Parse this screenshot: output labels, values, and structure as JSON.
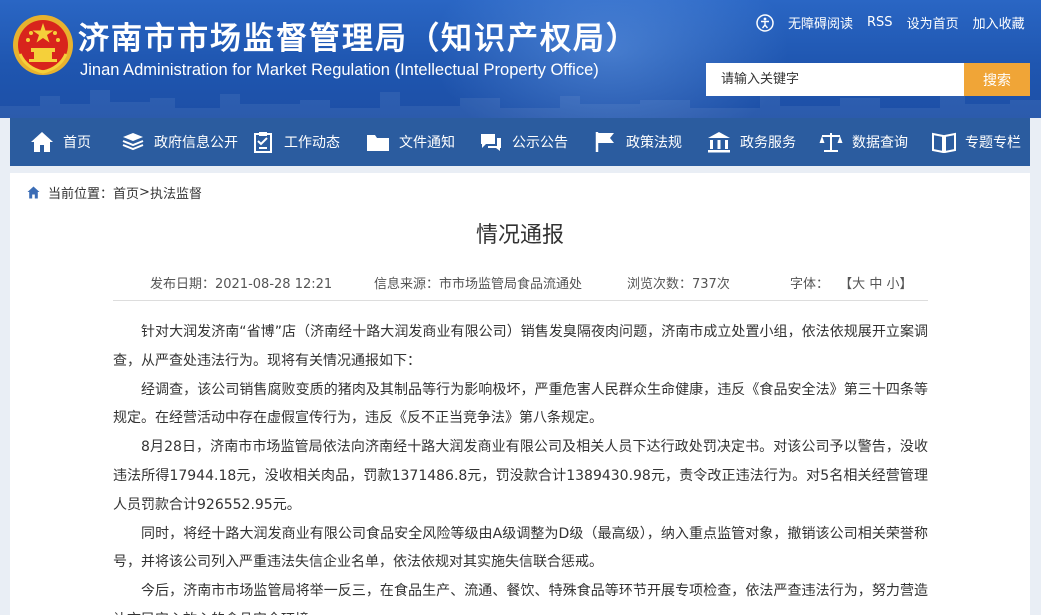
{
  "header": {
    "title_cn": "济南市市场监督管理局（知识产权局）",
    "title_en": "Jinan Administration for Market Regulation (Intellectual Property Office)",
    "emblem_icon": "national-emblem-icon",
    "toplinks": {
      "accessibility": "无障碍阅读",
      "rss": "RSS",
      "homepage": "设为首页",
      "favorite": "加入收藏"
    },
    "search": {
      "placeholder": "请输入关键字",
      "button": "搜索"
    }
  },
  "nav": {
    "items": [
      {
        "label": "首页",
        "icon": "home-icon"
      },
      {
        "label": "政府信息公开",
        "icon": "stack-icon"
      },
      {
        "label": "工作动态",
        "icon": "clipboard-icon"
      },
      {
        "label": "文件通知",
        "icon": "folder-icon"
      },
      {
        "label": "公示公告",
        "icon": "chat-icon"
      },
      {
        "label": "政策法规",
        "icon": "flag-icon"
      },
      {
        "label": "政务服务",
        "icon": "building-icon"
      },
      {
        "label": "数据查询",
        "icon": "scale-icon"
      },
      {
        "label": "专题专栏",
        "icon": "book-icon"
      }
    ]
  },
  "breadcrumb": {
    "prefix": "当前位置：",
    "home": "首页",
    "separator": ">",
    "current": "执法监督"
  },
  "article": {
    "title": "情况通报",
    "meta": {
      "date_label": "发布日期：",
      "date": "2021-08-28 12:21",
      "source_label": "信息来源：",
      "source": "市市场监管局食品流通处",
      "views_label": "浏览次数：",
      "views": "737次",
      "font_label": "字体：",
      "font_open": "【",
      "font_large": "大",
      "font_medium": "中",
      "font_small": "小",
      "font_close": "】"
    },
    "paragraphs": [
      "针对大润发济南“省博”店（济南经十路大润发商业有限公司）销售发臭隔夜肉问题，济南市成立处置小组，依法依规展开立案调查，从严查处违法行为。现将有关情况通报如下：",
      "经调查，该公司销售腐败变质的猪肉及其制品等行为影响极坏，严重危害人民群众生命健康，违反《食品安全法》第三十四条等规定。在经营活动中存在虚假宣传行为，违反《反不正当竞争法》第八条规定。",
      "8月28日，济南市市场监管局依法向济南经十路大润发商业有限公司及相关人员下达行政处罚决定书。对该公司予以警告，没收违法所得17944.18元，没收相关肉品，罚款1371486.8元，罚没款合计1389430.98元，责令改正违法行为。对5名相关经营管理人员罚款合计926552.95元。",
      "同时，将经十路大润发商业有限公司食品安全风险等级由A级调整为D级（最高级），纳入重点监管对象，撤销该公司相关荣誉称号，并将该公司列入严重违法失信企业名单，依法依规对其实施失信联合惩戒。",
      "今后，济南市市场监管局将举一反三，在食品生产、流通、餐饮、特殊食品等环节开展专项检查，依法严查违法行为，努力营造让市民安心放心的食品安全环境。"
    ]
  }
}
